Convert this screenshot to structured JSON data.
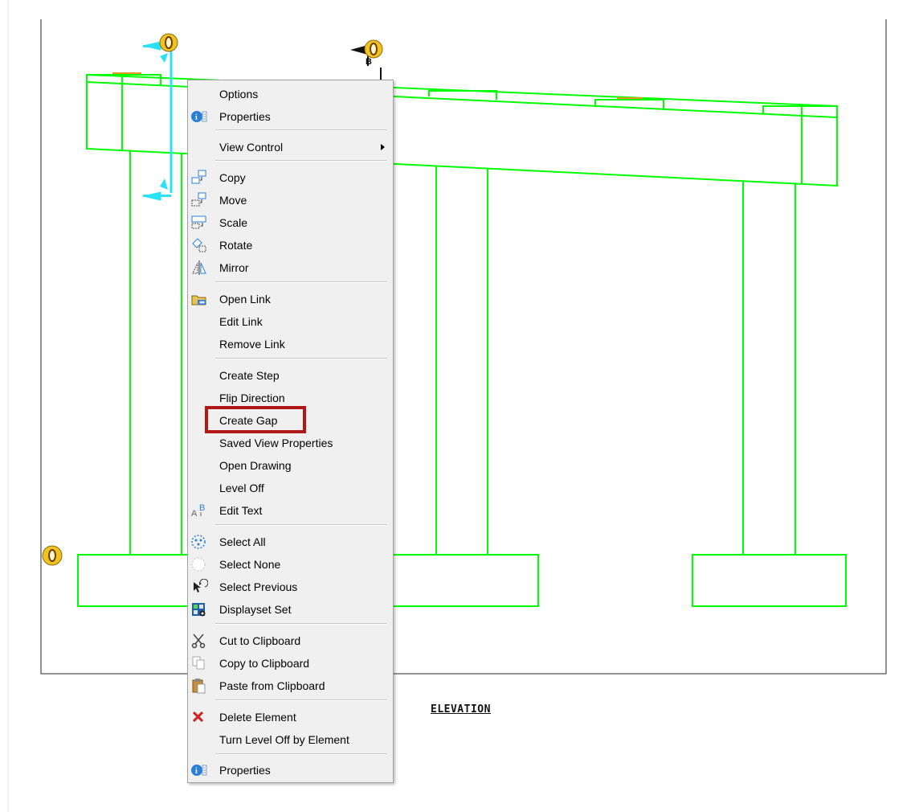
{
  "drawing": {
    "section_marker_letter": "B",
    "title": "ELEVATION",
    "line_color": "#00ff00",
    "marker_color": "#f2c21e",
    "handle_color": "#2be2f5"
  },
  "context_menu": {
    "items": [
      {
        "label": "Options",
        "icon": "none"
      },
      {
        "label": "Properties",
        "icon": "properties-icon"
      },
      {
        "label": "View Control",
        "icon": "none",
        "submenu": true
      },
      {
        "label": "Copy",
        "icon": "copy-icon"
      },
      {
        "label": "Move",
        "icon": "move-icon"
      },
      {
        "label": "Scale",
        "icon": "scale-icon"
      },
      {
        "label": "Rotate",
        "icon": "rotate-icon"
      },
      {
        "label": "Mirror",
        "icon": "mirror-icon"
      },
      {
        "label": "Open Link",
        "icon": "open-link-icon"
      },
      {
        "label": "Edit Link",
        "icon": "none"
      },
      {
        "label": "Remove Link",
        "icon": "none"
      },
      {
        "label": "Create Step",
        "icon": "none"
      },
      {
        "label": "Flip Direction",
        "icon": "none"
      },
      {
        "label": "Create Gap",
        "icon": "none",
        "highlighted": true
      },
      {
        "label": "Saved View Properties",
        "icon": "none"
      },
      {
        "label": "Open Drawing",
        "icon": "none"
      },
      {
        "label": "Level Off",
        "icon": "none"
      },
      {
        "label": "Edit Text",
        "icon": "edit-text-icon"
      },
      {
        "label": "Select All",
        "icon": "select-all-icon"
      },
      {
        "label": "Select None",
        "icon": "select-none-icon"
      },
      {
        "label": "Select Previous",
        "icon": "select-previous-icon"
      },
      {
        "label": "Displayset Set",
        "icon": "displayset-icon"
      },
      {
        "label": "Cut to Clipboard",
        "icon": "scissors-icon"
      },
      {
        "label": "Copy to Clipboard",
        "icon": "copy-clipboard-icon"
      },
      {
        "label": "Paste from Clipboard",
        "icon": "paste-icon"
      },
      {
        "label": "Delete Element",
        "icon": "delete-x-icon"
      },
      {
        "label": "Turn Level Off by Element",
        "icon": "none"
      },
      {
        "label": "Properties",
        "icon": "properties-icon"
      }
    ],
    "edit_text_icon_glyphs": {
      "a": "A",
      "b": "B"
    }
  }
}
